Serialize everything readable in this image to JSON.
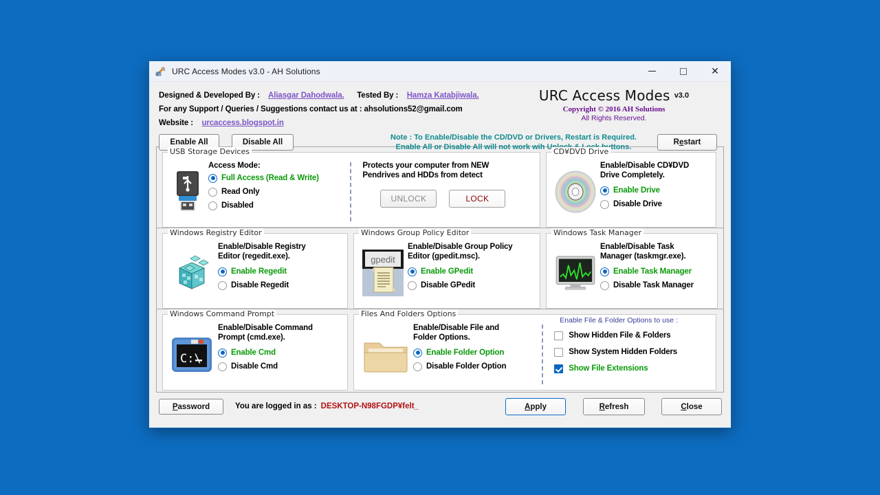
{
  "window": {
    "title": "URC Access Modes v3.0 - AH Solutions",
    "icon": "app-icon",
    "minimize": "—",
    "maximize": "□",
    "close": "✕"
  },
  "header": {
    "designed_label": "Designed & Developed By :",
    "designed_name": "Aliasgar Dahodwala.",
    "tested_label": "Tested By :",
    "tested_name": "Hamza Katabjiwala.",
    "support_line": "For any Support / Queries / Suggestions contact us at :  ahsolutions52@gmail.com",
    "website_label": "Website :",
    "website_link": "urcaccess.blogspot.in",
    "brand_title": "URC Access Modes",
    "brand_version": "v3.0",
    "copyright": "Copyright © 2016 AH Solutions",
    "rights": "All Rights Reserved.",
    "enable_all": "Enable All",
    "disable_all": "Disable All",
    "restart": "Restart",
    "note_line1": "Note : To Enable/Disable the CD/DVD or Drivers, Restart is Required.",
    "note_line2": "Enable All or Disable All will not work wih Unlock & Lock buttons."
  },
  "usb": {
    "group_title": "USB Storage Devices",
    "icon": "usb-drive-icon",
    "access_mode_label": "Access Mode:",
    "options": [
      {
        "label": "Full Access (Read & Write)",
        "selected": true
      },
      {
        "label": "Read Only",
        "selected": false
      },
      {
        "label": "Disabled",
        "selected": false
      }
    ]
  },
  "protect": {
    "desc_line1": "Protects your computer from NEW",
    "desc_line2": "Pendrives and HDDs from detect",
    "unlock": "UNLOCK",
    "lock": "LOCK"
  },
  "cddvd": {
    "group_title": "CD¥DVD Drive",
    "icon": "cd-disc-icon",
    "desc_line1": "Enable/Disable CD¥DVD",
    "desc_line2": "Drive Completely.",
    "options": [
      {
        "label": "Enable Drive",
        "selected": true
      },
      {
        "label": "Disable Drive",
        "selected": false
      }
    ]
  },
  "regedit": {
    "group_title": "Windows Registry Editor",
    "icon": "registry-blocks-icon",
    "desc_line1": "Enable/Disable Registry",
    "desc_line2": "Editor (regedit.exe).",
    "options": [
      {
        "label": "Enable Regedit",
        "selected": true
      },
      {
        "label": "Disable Regedit",
        "selected": false
      }
    ]
  },
  "gpedit": {
    "group_title": "Windows Group Policy Editor",
    "icon": "gpedit-scroll-icon",
    "icon_caption": "gpedit",
    "desc_line1": "Enable/Disable Group Policy",
    "desc_line2": "Editor (gpedit.msc).",
    "options": [
      {
        "label": "Enable GPedit",
        "selected": true
      },
      {
        "label": "Disable GPedit",
        "selected": false
      }
    ]
  },
  "taskmgr": {
    "group_title": "Windows Task Manager",
    "icon": "task-manager-monitor-icon",
    "desc_line1": "Enable/Disable Task",
    "desc_line2": "Manager (taskmgr.exe).",
    "options": [
      {
        "label": "Enable Task Manager",
        "selected": true
      },
      {
        "label": "Disable Task Manager",
        "selected": false
      }
    ]
  },
  "cmd": {
    "group_title": "Windows Command Prompt",
    "icon": "command-prompt-icon",
    "icon_caption": "C:\\_",
    "desc_line1": "Enable/Disable Command",
    "desc_line2": "Prompt (cmd.exe).",
    "options": [
      {
        "label": "Enable Cmd",
        "selected": true
      },
      {
        "label": "Disable Cmd",
        "selected": false
      }
    ]
  },
  "folder_options": {
    "group_title": "Files And Folders Options",
    "icon": "folder-icon",
    "desc_line1": "Enable/Disable File and",
    "desc_line2": "Folder Options.",
    "options": [
      {
        "label": "Enable Folder Option",
        "selected": true
      },
      {
        "label": "Disable Folder Option",
        "selected": false
      }
    ]
  },
  "folder_checks": {
    "group_title": "Enable File & Folder Options to use :",
    "items": [
      {
        "label": "Show Hidden File & Folders",
        "checked": false
      },
      {
        "label": "Show System Hidden Folders",
        "checked": false
      },
      {
        "label": "Show File Extensions",
        "checked": true
      }
    ]
  },
  "footer": {
    "password": "Password",
    "password_accel": "P",
    "logged_in_label": "You are logged in as :",
    "logged_in_user": "DESKTOP-N98FGDP¥felt_",
    "apply": "Apply",
    "apply_accel": "A",
    "refresh": "Refresh",
    "refresh_accel": "R",
    "close": "Close",
    "close_accel": "C"
  },
  "colors": {
    "desktop": "#0d6cc0",
    "accent": "#0a66c2",
    "enabled_green": "#0a9a0a",
    "note_teal": "#118a8f",
    "link_purple": "#7d56c6",
    "copyright_purple": "#6a0f8f",
    "user_red": "#b31212",
    "lock_red": "#8b0000"
  }
}
